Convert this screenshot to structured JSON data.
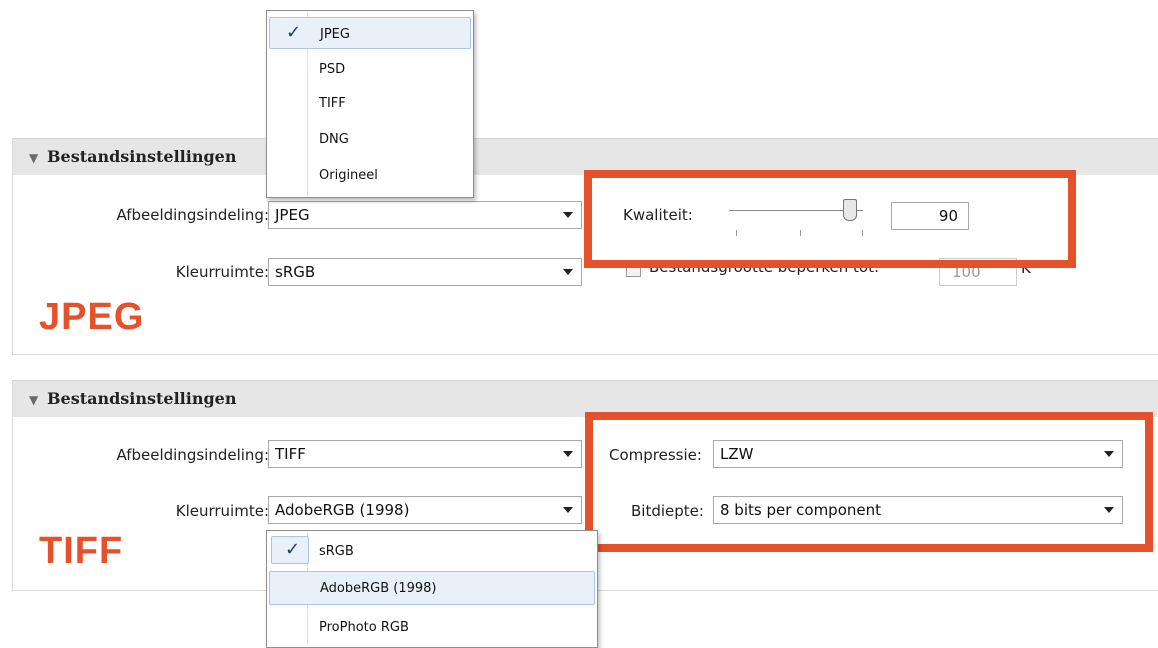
{
  "jpeg_panel": {
    "header": "Bestandsinstellingen",
    "format_label": "Afbeeldingsindeling:",
    "format_value": "JPEG",
    "colorspace_label": "Kleurruimte:",
    "colorspace_value": "sRGB",
    "quality_label": "Kwaliteit:",
    "quality_value": "90",
    "quality_level": 90,
    "limit_label": "Bestandsgrootte beperken tot:",
    "limit_value": "100",
    "limit_unit": "K",
    "limit_checked": false,
    "tag": "JPEG"
  },
  "format_menu": {
    "items": [
      "JPEG",
      "PSD",
      "TIFF",
      "DNG",
      "Origineel"
    ],
    "selected": "JPEG"
  },
  "tiff_panel": {
    "header": "Bestandsinstellingen",
    "format_label": "Afbeeldingsindeling:",
    "format_value": "TIFF",
    "colorspace_label": "Kleurruimte:",
    "colorspace_value": "AdobeRGB (1998)",
    "compression_label": "Compressie:",
    "compression_value": "LZW",
    "bitdepth_label": "Bitdiepte:",
    "bitdepth_value": "8 bits per component",
    "tag": "TIFF"
  },
  "colorspace_menu": {
    "items": [
      "sRGB",
      "AdobeRGB (1998)",
      "ProPhoto RGB"
    ],
    "checked": "sRGB",
    "highlighted": "AdobeRGB (1998)"
  },
  "colors": {
    "accent": "#e4512b",
    "header_bg": "#e6e6e6",
    "menu_highlight": "#e8f0fa"
  }
}
